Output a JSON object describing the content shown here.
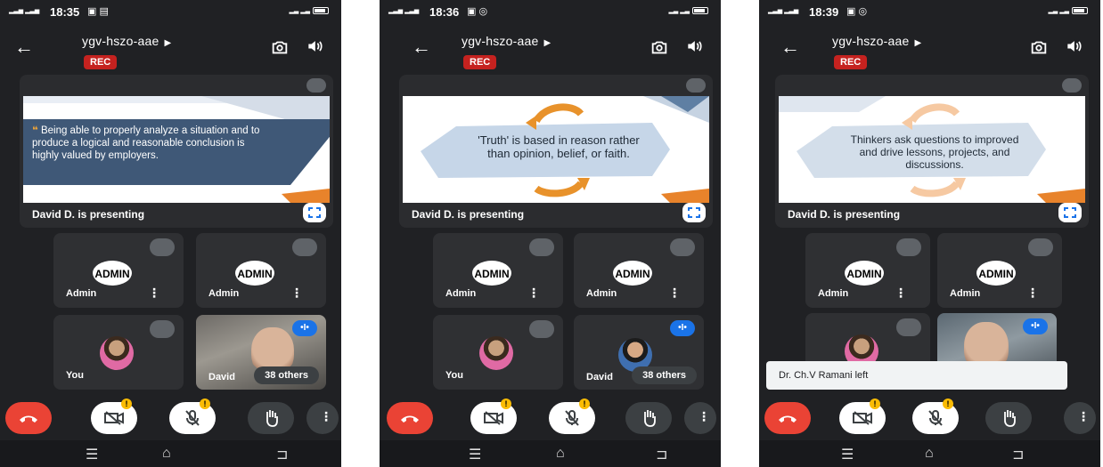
{
  "colors": {
    "background": "#202124",
    "tile": "#2f3033",
    "rec": "#c5221f",
    "hangup": "#ea4335",
    "talking": "#1a73e8",
    "warning": "#fbbc04",
    "slide_accent": "#e8832b"
  },
  "screens": [
    {
      "status_time": "18:35",
      "meeting_code": "ygv-hszo-aae",
      "rec_label": "REC",
      "slide_text": "Being able to properly analyze a situation and to produce a logical and reasonable conclusion is highly valued by employers.",
      "presenting_label": "David D. is presenting",
      "tiles": [
        {
          "name": "Admin",
          "type": "admin"
        },
        {
          "name": "Admin",
          "type": "admin"
        },
        {
          "name": "You",
          "type": "avatar"
        },
        {
          "name": "David",
          "type": "video",
          "others": "38 others"
        }
      ]
    },
    {
      "status_time": "18:36",
      "meeting_code": "ygv-hszo-aae",
      "rec_label": "REC",
      "slide_text": "'Truth' is based in reason rather than opinion, belief, or faith.",
      "presenting_label": "David D. is presenting",
      "tiles": [
        {
          "name": "Admin",
          "type": "admin"
        },
        {
          "name": "Admin",
          "type": "admin"
        },
        {
          "name": "You",
          "type": "avatar"
        },
        {
          "name": "David",
          "type": "video",
          "others": "38 others"
        }
      ]
    },
    {
      "status_time": "18:39",
      "meeting_code": "ygv-hszo-aae",
      "rec_label": "REC",
      "slide_text": "Thinkers ask questions to improved and drive lessons, projects, and discussions.",
      "presenting_label": "David D. is presenting",
      "tiles": [
        {
          "name": "Admin",
          "type": "admin"
        },
        {
          "name": "Admin",
          "type": "admin"
        },
        {
          "name": "",
          "type": "avatar"
        },
        {
          "name": "",
          "type": "video"
        }
      ],
      "toast": "Dr. Ch.V Ramani left"
    }
  ],
  "icons": {
    "back": "arrow-left-icon",
    "camera_switch": "camera-switch-icon",
    "speaker": "speaker-icon",
    "mic_off": "mic-off-icon",
    "fullscreen": "fullscreen-icon",
    "hangup": "phone-hangup-icon",
    "camera_off": "camera-off-icon",
    "hand": "raise-hand-icon",
    "more": "more-vert-icon"
  }
}
